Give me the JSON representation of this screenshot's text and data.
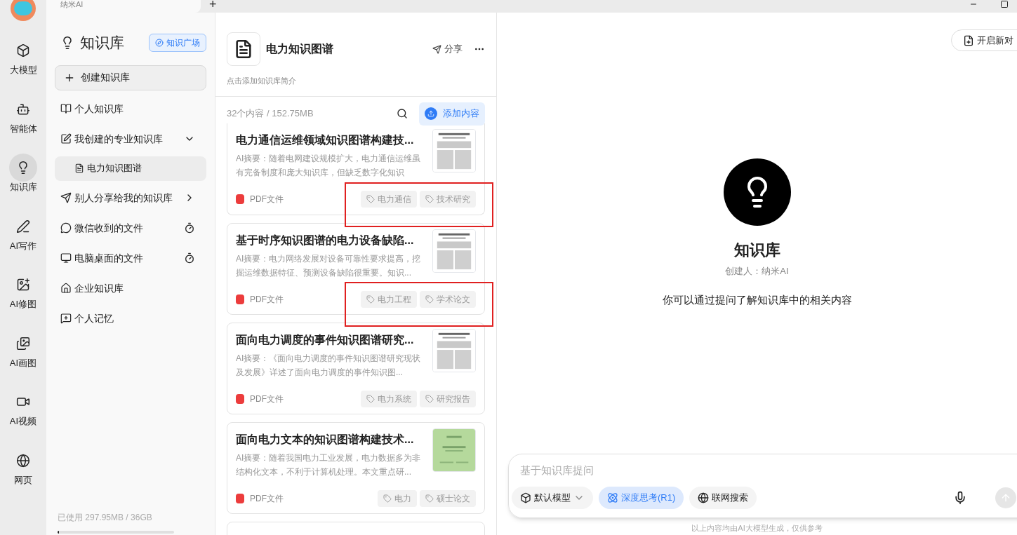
{
  "browser_tab": {
    "title": "纳米AI",
    "new_tab": "+"
  },
  "nav_rail": [
    {
      "label": "大模型",
      "selected": false
    },
    {
      "label": "智能体",
      "selected": false
    },
    {
      "label": "知识库",
      "selected": true
    },
    {
      "label": "AI写作",
      "selected": false
    },
    {
      "label": "AI修图",
      "selected": false
    },
    {
      "label": "AI画图",
      "selected": false
    },
    {
      "label": "AI视频",
      "selected": false
    },
    {
      "label": "网页",
      "selected": false
    }
  ],
  "sidebar": {
    "title": "知识库",
    "plaza_button": "知识广场",
    "create_button": "创建知识库",
    "items": [
      {
        "label": "个人知识库",
        "kind": "plain",
        "selected": false
      },
      {
        "label": "我创建的专业知识库",
        "kind": "expandable",
        "expanded": true,
        "selected": false,
        "children": [
          {
            "label": "电力知识图谱",
            "selected": true
          }
        ]
      },
      {
        "label": "别人分享给我的知识库",
        "kind": "expandable",
        "expanded": false,
        "selected": false
      },
      {
        "label": "微信收到的文件",
        "kind": "timed",
        "selected": false
      },
      {
        "label": "电脑桌面的文件",
        "kind": "timed",
        "selected": false
      },
      {
        "label": "企业知识库",
        "kind": "plain",
        "selected": false
      },
      {
        "label": "个人记忆",
        "kind": "plain",
        "selected": false
      }
    ],
    "storage": {
      "text": "已使用 297.95MB / 36GB",
      "level": 0.008
    }
  },
  "knowledge_base": {
    "title": "电力知识图谱",
    "share_button": "分享",
    "description": "点击添加知识库简介",
    "count": "32个内容 / 152.75MB",
    "add_button": "添加内容",
    "documents": [
      {
        "title": "电力通信运维领域知识图谱构建技...",
        "summary": "AI摘要：随着电网建设规模扩大，电力通信运维虽有完备制度和庞大知识库，但缺乏数字化知识",
        "type": "PDF文件",
        "tags": [
          "电力通信",
          "技术研究"
        ],
        "highlighted": true
      },
      {
        "title": "基于时序知识图谱的电力设备缺陷...",
        "summary": "AI摘要：电力网络发展对设备可靠性要求提高，挖掘运维数据特征、预测设备缺陷很重要。知识...",
        "type": "PDF文件",
        "tags": [
          "电力工程",
          "学术论文"
        ],
        "highlighted": true
      },
      {
        "title": "面向电力调度的事件知识图谱研究...",
        "summary": "AI摘要：《面向电力调度的事件知识图谱研究现状及发展》详述了面向电力调度的事件知识图...",
        "type": "PDF文件",
        "tags": [
          "电力系统",
          "研究报告"
        ],
        "highlighted": false
      },
      {
        "title": "面向电力文本的知识图谱构建技术...",
        "summary": "AI摘要：随着我国电力工业发展，电力数据多为非结构化文本，不利于计算机处理。本文重点研...",
        "type": "PDF文件",
        "tags": [
          "电力",
          "硕士论文"
        ],
        "highlighted": false
      }
    ]
  },
  "chat": {
    "new_chat_button": "开启新对",
    "title": "知识库",
    "creator": "创建人：纳米AI",
    "intro": "你可以通过提问了解知识库中的相关内容",
    "input_placeholder": "基于知识库提问",
    "options": [
      {
        "label": "默认模型",
        "kind": "dropdown",
        "selected": false
      },
      {
        "label": "深度思考(R1)",
        "kind": "toggle",
        "selected": true
      },
      {
        "label": "联网搜索",
        "kind": "toggle",
        "selected": false
      }
    ],
    "footer": "以上内容均由AI大模型生成，仅供参考"
  }
}
